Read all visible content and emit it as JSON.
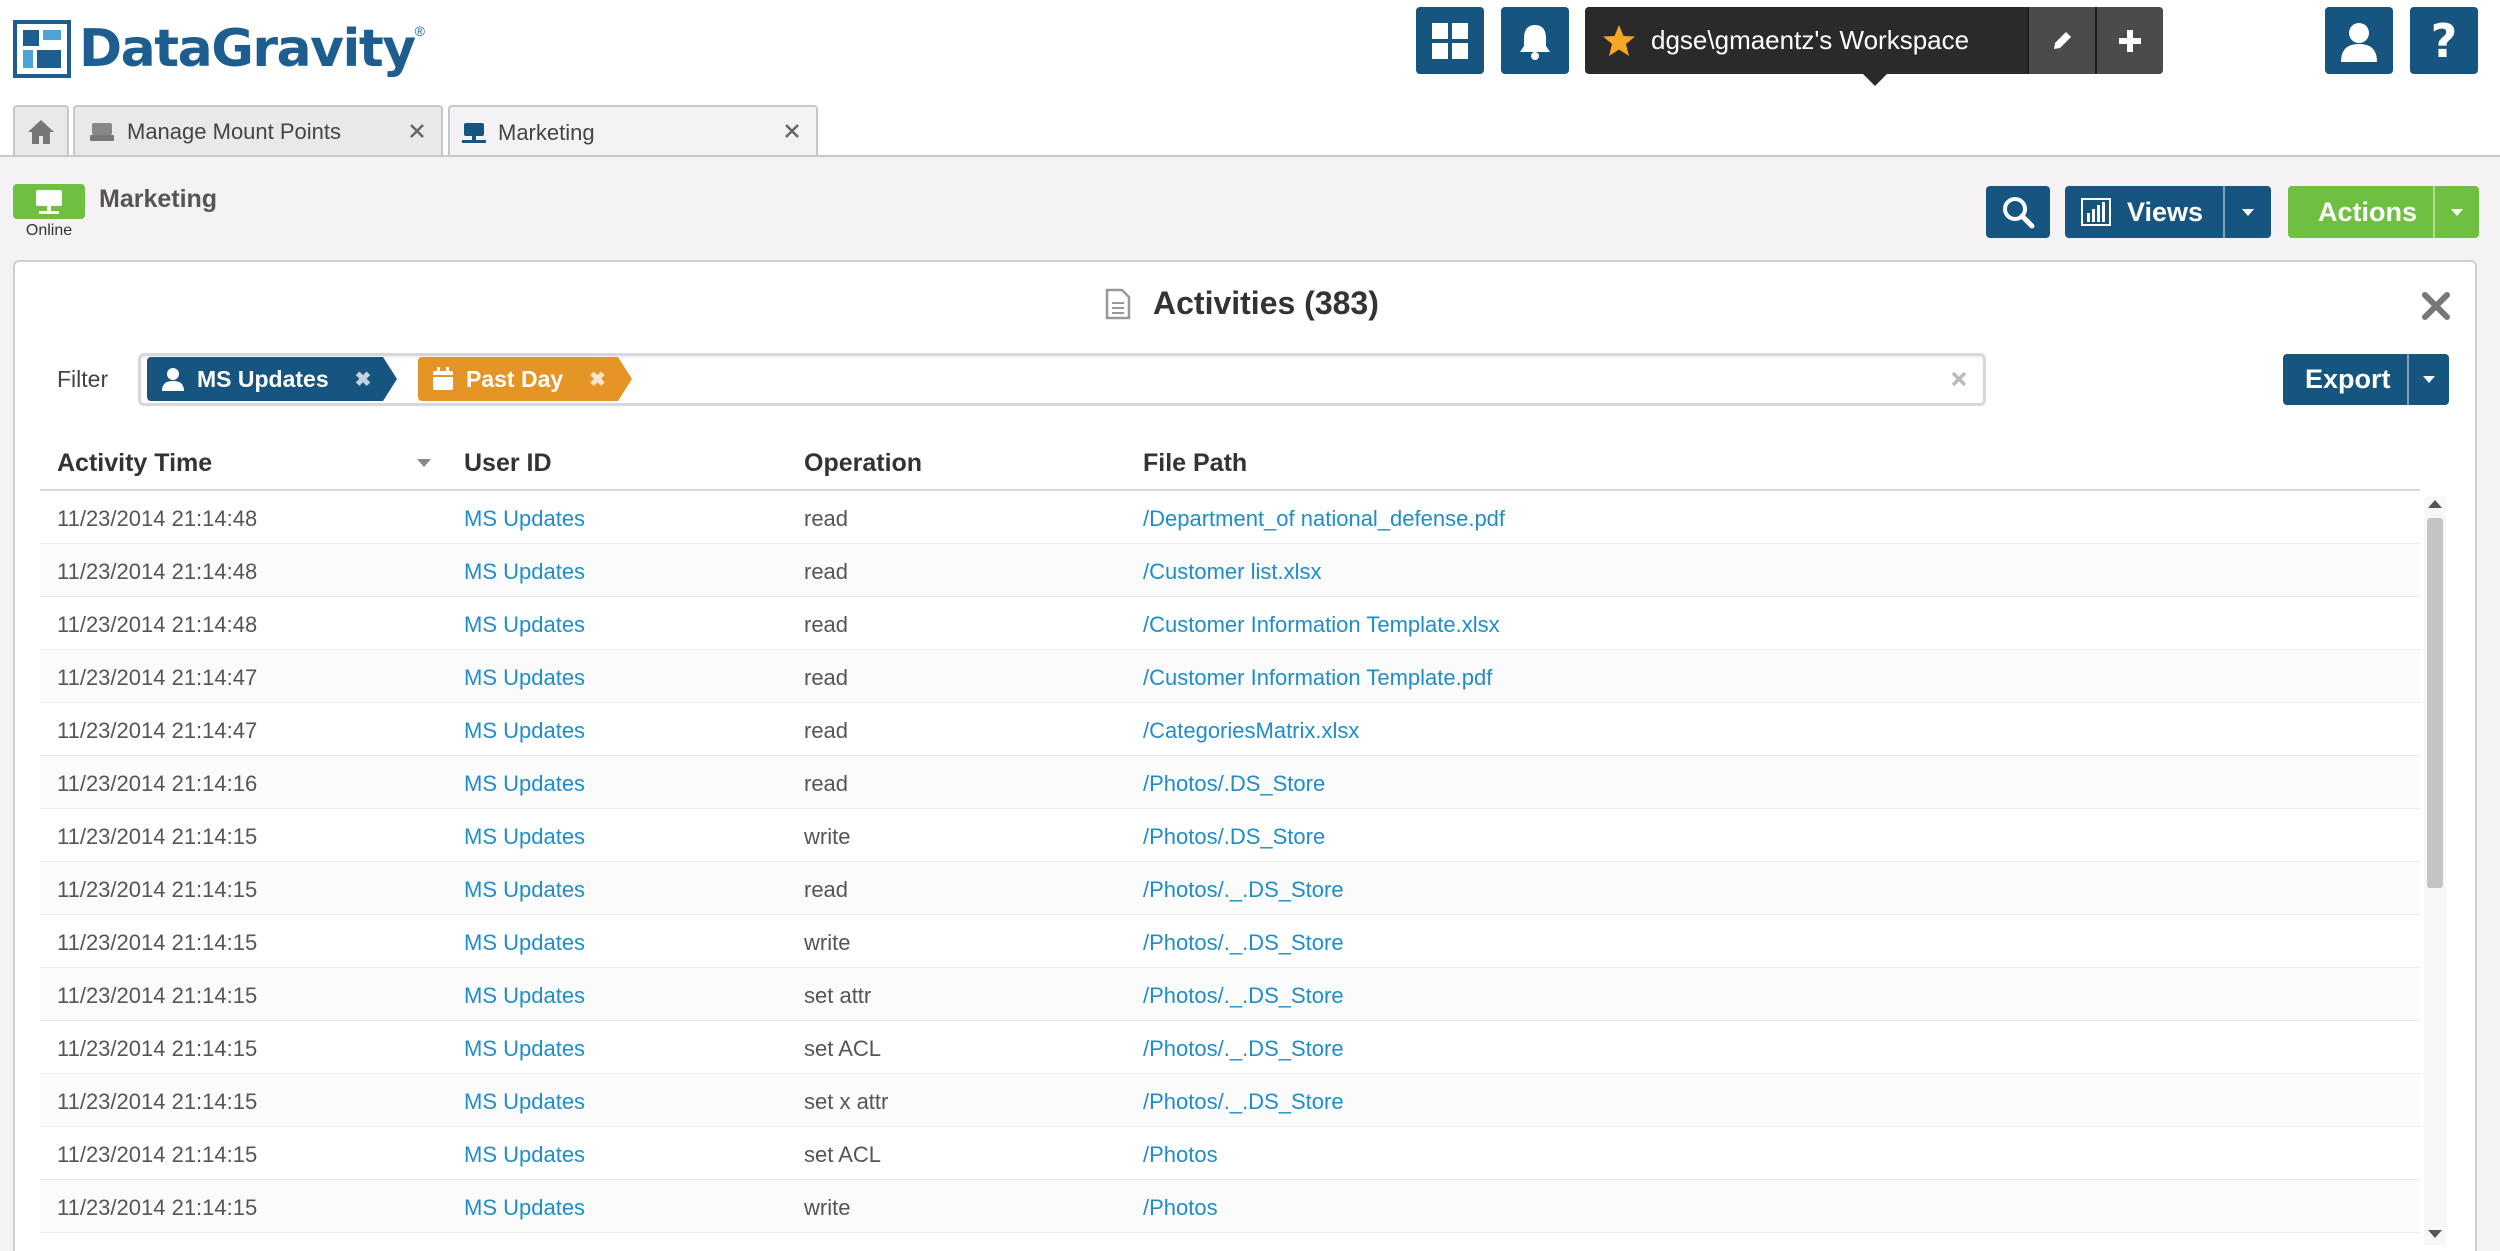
{
  "app": {
    "logo_text": "DataGravity",
    "logo_tm": "®"
  },
  "header": {
    "workspace_label": "dgse\\gmaentz's Workspace",
    "icons": [
      "dashboard-grid-icon",
      "bell-icon",
      "star-icon",
      "pencil-icon",
      "plus-icon",
      "user-icon",
      "help-icon"
    ]
  },
  "tabs": [
    {
      "label": "",
      "icon": "home-icon"
    },
    {
      "label": "Manage Mount Points",
      "icon": "drive-icon"
    },
    {
      "label": "Marketing",
      "icon": "mount-point-icon"
    }
  ],
  "mount_point": {
    "title": "Marketing",
    "status": "Online"
  },
  "toolbar": {
    "views_label": "Views",
    "actions_label": "Actions"
  },
  "panel": {
    "title": "Activities (383)"
  },
  "filter": {
    "label": "Filter",
    "chips": [
      {
        "label": "MS Updates",
        "color": "#15557f",
        "icon": "user-icon"
      },
      {
        "label": "Past Day",
        "color": "#e59426",
        "icon": "calendar-icon"
      }
    ]
  },
  "export": {
    "label": "Export"
  },
  "table": {
    "columns": [
      "Activity Time",
      "User ID",
      "Operation",
      "File Path"
    ],
    "rows": [
      [
        "11/23/2014 21:14:48",
        "MS Updates",
        "read",
        "/Department_of national_defense.pdf"
      ],
      [
        "11/23/2014 21:14:48",
        "MS Updates",
        "read",
        "/Customer list.xlsx"
      ],
      [
        "11/23/2014 21:14:48",
        "MS Updates",
        "read",
        "/Customer Information Template.xlsx"
      ],
      [
        "11/23/2014 21:14:47",
        "MS Updates",
        "read",
        "/Customer Information Template.pdf"
      ],
      [
        "11/23/2014 21:14:47",
        "MS Updates",
        "read",
        "/CategoriesMatrix.xlsx"
      ],
      [
        "11/23/2014 21:14:16",
        "MS Updates",
        "read",
        "/Photos/.DS_Store"
      ],
      [
        "11/23/2014 21:14:15",
        "MS Updates",
        "write",
        "/Photos/.DS_Store"
      ],
      [
        "11/23/2014 21:14:15",
        "MS Updates",
        "read",
        "/Photos/._.DS_Store"
      ],
      [
        "11/23/2014 21:14:15",
        "MS Updates",
        "write",
        "/Photos/._.DS_Store"
      ],
      [
        "11/23/2014 21:14:15",
        "MS Updates",
        "set attr",
        "/Photos/._.DS_Store"
      ],
      [
        "11/23/2014 21:14:15",
        "MS Updates",
        "set ACL",
        "/Photos/._.DS_Store"
      ],
      [
        "11/23/2014 21:14:15",
        "MS Updates",
        "set x attr",
        "/Photos/._.DS_Store"
      ],
      [
        "11/23/2014 21:14:15",
        "MS Updates",
        "set ACL",
        "/Photos"
      ],
      [
        "11/23/2014 21:14:15",
        "MS Updates",
        "write",
        "/Photos"
      ]
    ]
  },
  "colors": {
    "brand": "#15557f",
    "accent_green": "#6fbf40",
    "link": "#1f8dc9",
    "chip_orange": "#e59426"
  }
}
